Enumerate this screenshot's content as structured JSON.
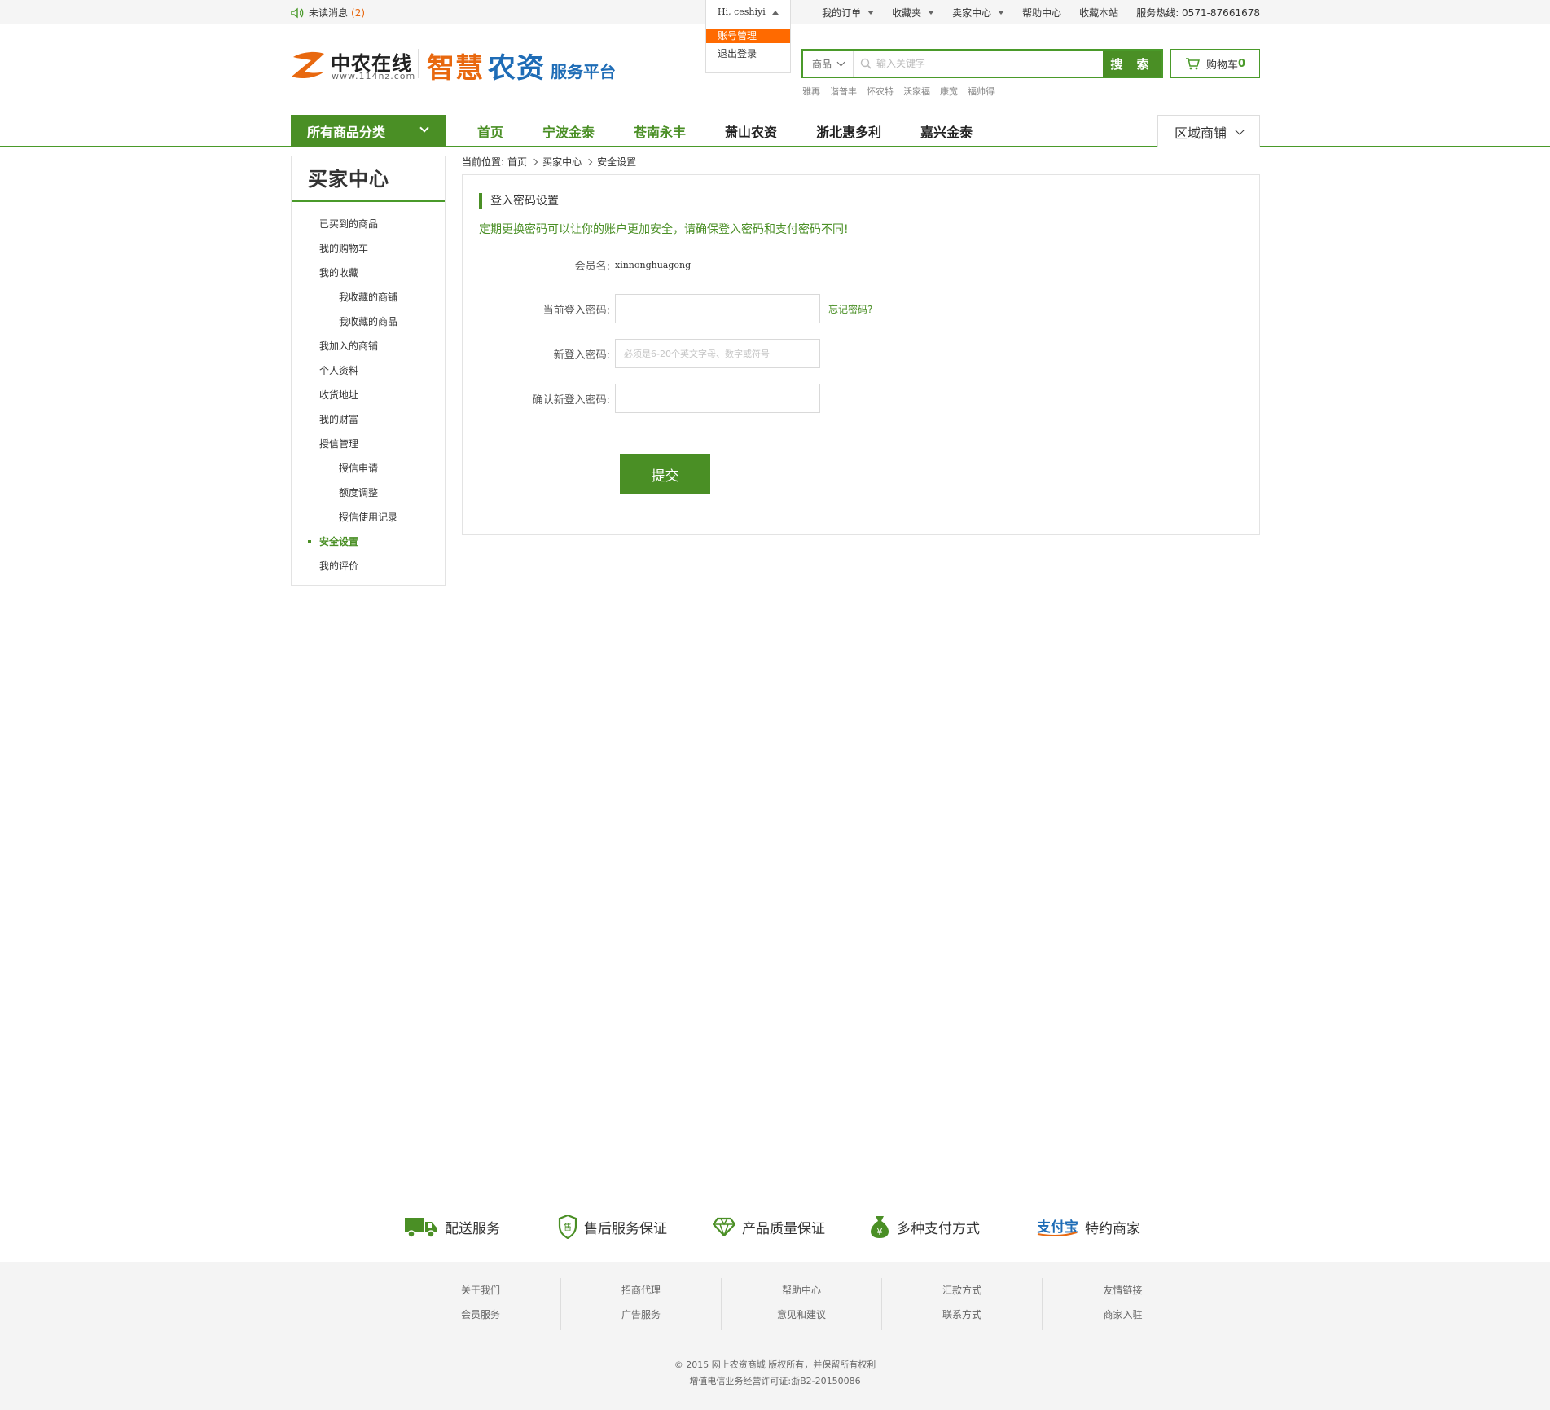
{
  "topbar": {
    "unread_label": "未读消息",
    "unread_count": "(2)",
    "greeting": "Hi, ceshiyi",
    "user_menu": [
      "账号管理",
      "退出登录"
    ],
    "links": [
      "我的订单",
      "收藏夹",
      "卖家中心",
      "帮助中心",
      "收藏本站"
    ],
    "hotline": "服务热线: 0571-87661678"
  },
  "logo": {
    "brand": "中农在线",
    "url": "www.114nz.com",
    "platform_part1": "智慧",
    "platform_part2": "农资",
    "platform_part3": "服务平台"
  },
  "search": {
    "category": "商品",
    "placeholder": "输入关键字",
    "button": "搜 索",
    "hotwords": [
      "雅再",
      "谐普丰",
      "怀农特",
      "沃家福",
      "康宽",
      "福帅得"
    ]
  },
  "cart": {
    "label": "购物车",
    "count": "0"
  },
  "nav": {
    "all_categories": "所有商品分类",
    "links": [
      "首页",
      "宁波金泰",
      "苍南永丰",
      "萧山农资",
      "浙北惠多利",
      "嘉兴金泰"
    ],
    "region": "区域商铺"
  },
  "sidebar": {
    "title": "买家中心",
    "items": [
      {
        "label": "已买到的商品"
      },
      {
        "label": "我的购物车"
      },
      {
        "label": "我的收藏"
      },
      {
        "label": "我收藏的商铺"
      },
      {
        "label": "我收藏的商品"
      },
      {
        "label": "我加入的商铺"
      },
      {
        "label": "个人资料"
      },
      {
        "label": "收货地址"
      },
      {
        "label": "我的财富"
      },
      {
        "label": "授信管理"
      },
      {
        "label": "授信申请"
      },
      {
        "label": "额度调整"
      },
      {
        "label": "授信使用记录"
      },
      {
        "label": "安全设置"
      },
      {
        "label": "我的评价"
      }
    ]
  },
  "breadcrumb": {
    "prefix": "当前位置:",
    "items": [
      "首页",
      "买家中心",
      "安全设置"
    ]
  },
  "form": {
    "title": "登入密码设置",
    "tip": "定期更换密码可以让你的账户更加安全，请确保登入密码和支付密码不同!",
    "member_label": "会员名:",
    "member_value": "xinnonghuagong",
    "current_label": "当前登入密码:",
    "current_value": "",
    "forgot": "忘记密码?",
    "new_label": "新登入密码:",
    "new_placeholder": "必须是6-20个英文字母、数字或符号",
    "confirm_label": "确认新登入密码:",
    "confirm_value": "",
    "submit": "提交"
  },
  "services": [
    "配送服务",
    "售后服务保证",
    "产品质量保证",
    "多种支付方式",
    "特约商家"
  ],
  "services_alipay_text": "支付宝",
  "footer": {
    "columns": [
      [
        "关于我们",
        "会员服务"
      ],
      [
        "招商代理",
        "广告服务"
      ],
      [
        "帮助中心",
        "意见和建议"
      ],
      [
        "汇款方式",
        "联系方式"
      ],
      [
        "友情链接",
        "商家入驻"
      ]
    ],
    "copyright": "© 2015 网上农资商城 版权所有，并保留所有权利",
    "license": "增值电信业务经营许可证:浙B2-20150086"
  },
  "colors": {
    "accent": "#4a8f25",
    "orange": "#ff6a00",
    "brand_blue": "#1e6cb6"
  }
}
